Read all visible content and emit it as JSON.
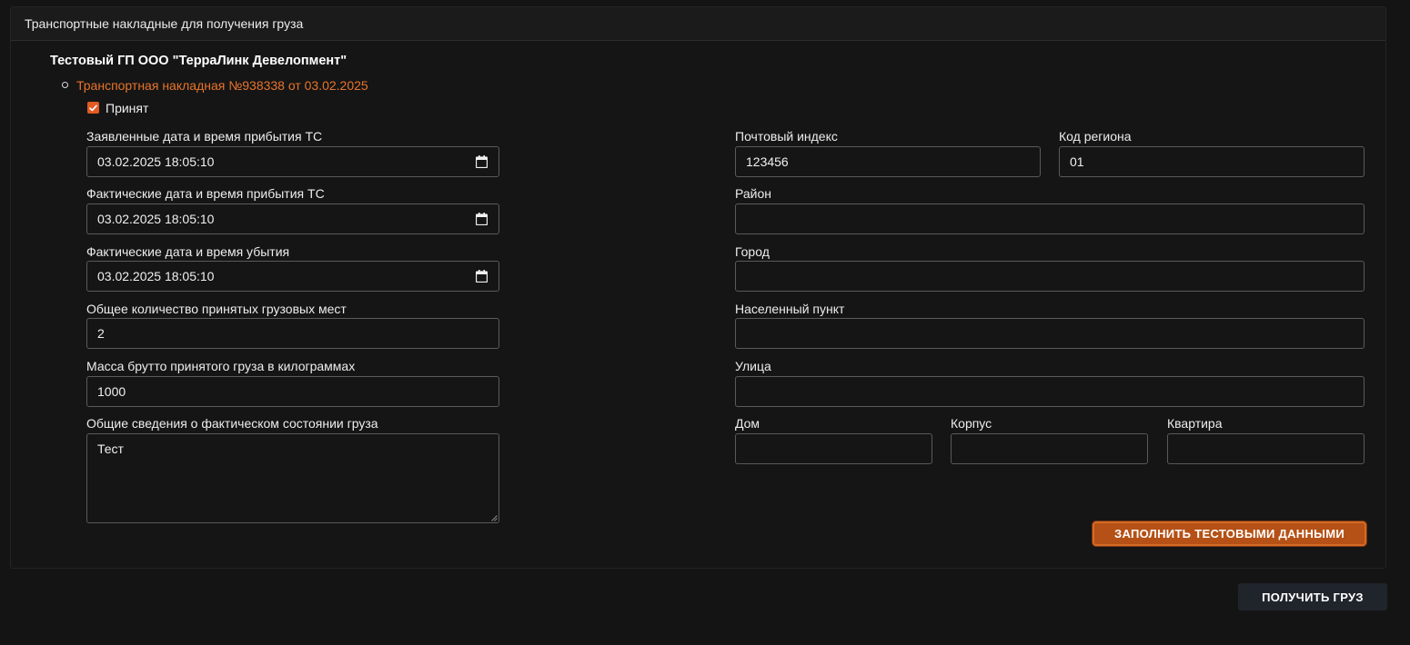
{
  "panel": {
    "title": "Транспортные накладные для получения груза"
  },
  "organization": "Тестовый ГП ООО \"ТерраЛинк Девелопмент\"",
  "waybill": {
    "link_text": "Транспортная накладная №938338 от 03.02.2025",
    "accepted_label": "Принят",
    "accepted_checked": true
  },
  "left_fields": {
    "declared_arrival": {
      "label": "Заявленные дата и время прибытия ТС",
      "value": "03.02.2025 18:05:10"
    },
    "actual_arrival": {
      "label": "Фактические дата и время прибытия ТС",
      "value": "03.02.2025 18:05:10"
    },
    "actual_departure": {
      "label": "Фактические дата и время убытия",
      "value": "03.02.2025 18:05:10"
    },
    "places_count": {
      "label": "Общее количество принятых грузовых мест",
      "value": "2"
    },
    "gross_mass": {
      "label": "Масса брутто принятого груза в килограммах",
      "value": "1000"
    },
    "condition": {
      "label": "Общие сведения о фактическом состоянии груза",
      "value": "Тест"
    }
  },
  "address_fields": {
    "postal_code": {
      "label": "Почтовый индекс",
      "value": "123456"
    },
    "region_code": {
      "label": "Код региона",
      "value": "01"
    },
    "district": {
      "label": "Район",
      "value": ""
    },
    "city": {
      "label": "Город",
      "value": ""
    },
    "locality": {
      "label": "Населенный пункт",
      "value": ""
    },
    "street": {
      "label": "Улица",
      "value": ""
    },
    "house": {
      "label": "Дом",
      "value": ""
    },
    "building": {
      "label": "Корпус",
      "value": ""
    },
    "apartment": {
      "label": "Квартира",
      "value": ""
    }
  },
  "buttons": {
    "fill_test": "ЗАПОЛНИТЬ ТЕСТОВЫМИ ДАННЫМИ",
    "get_cargo": "ПОЛУЧИТЬ ГРУЗ"
  },
  "colors": {
    "accent": "#e8742a",
    "checkbox": "#e35a22",
    "fill_button": "#b55116",
    "background": "#141414"
  }
}
